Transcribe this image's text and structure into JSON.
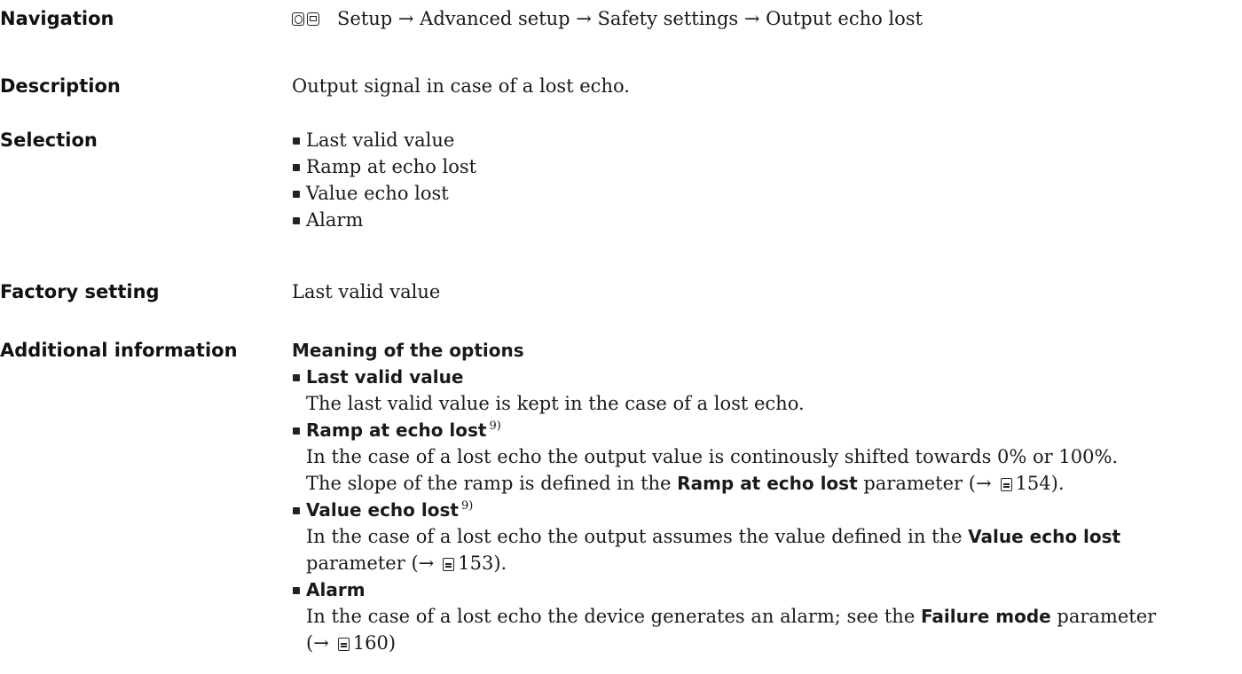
{
  "navigation": {
    "label": "Navigation",
    "icons": [
      "operation-icon",
      "display-icon"
    ],
    "path": "Setup → Advanced setup → Safety settings → Output echo lost"
  },
  "description": {
    "label": "Description",
    "text": "Output signal in case of a lost echo."
  },
  "selection": {
    "label": "Selection",
    "options": [
      "Last valid value",
      "Ramp at echo lost",
      "Value echo lost",
      "Alarm"
    ]
  },
  "factory_setting": {
    "label": "Factory setting",
    "value": "Last valid value"
  },
  "additional_information": {
    "label": "Additional information",
    "heading": "Meaning of the options",
    "items": [
      {
        "title": "Last valid value",
        "footnote": "",
        "lines": [
          "The last valid value is kept in the case of a lost echo."
        ]
      },
      {
        "title": "Ramp at echo lost",
        "footnote": "9)",
        "line1": "In the case of a lost echo the output value is continously shifted towards 0% or 100%.",
        "line2_pre": "The slope of the ramp is defined in the ",
        "line2_bold": "Ramp at echo lost",
        "line2_post": " parameter (→",
        "line2_page": "154).",
        "ref_icon": "page-reference-icon"
      },
      {
        "title": "Value echo lost",
        "footnote": "9)",
        "line1_pre": "In the case of a lost echo the output assumes the value defined in the ",
        "line1_bold": "Value echo lost",
        "line2_pre": "parameter (→",
        "line2_page": "153).",
        "ref_icon": "page-reference-icon"
      },
      {
        "title": "Alarm",
        "footnote": "",
        "line1_pre": "In the case of a lost echo the device generates an alarm; see the ",
        "line1_bold": "Failure mode",
        "line1_post": " parameter",
        "line2_pre": "(→",
        "line2_page": "160)",
        "ref_icon": "page-reference-icon"
      }
    ]
  }
}
